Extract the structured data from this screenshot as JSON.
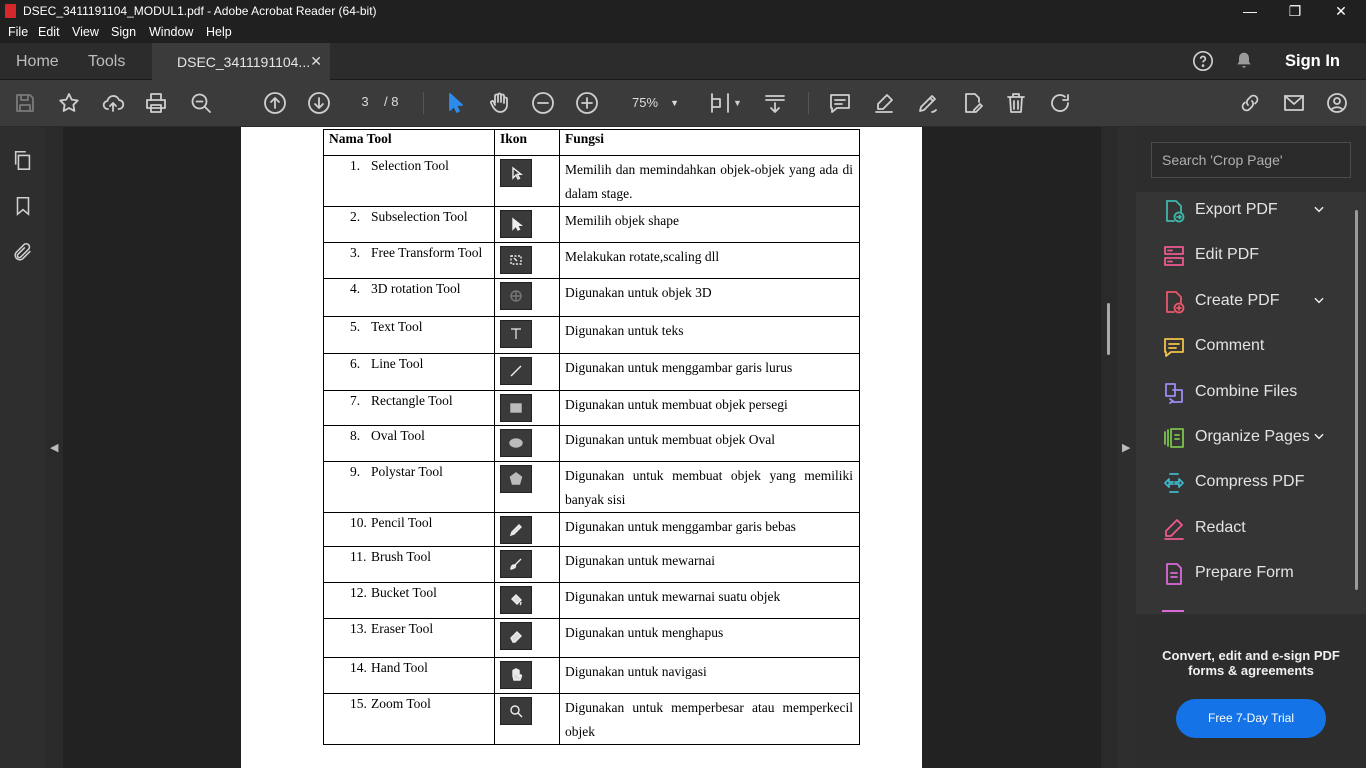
{
  "titlebar": {
    "title": "DSEC_3411191104_MODUL1.pdf - Adobe Acrobat Reader (64-bit)"
  },
  "menu": [
    "File",
    "Edit",
    "View",
    "Sign",
    "Window",
    "Help"
  ],
  "tabs": {
    "home": "Home",
    "tools": "Tools",
    "doc": "DSEC_3411191104...",
    "sign_in": "Sign In"
  },
  "toolbar": {
    "page_current": "3",
    "page_total": "/ 8",
    "zoom": "75%"
  },
  "right_panel": {
    "search_placeholder": "Search 'Crop Page'",
    "tools": [
      {
        "label": "Export PDF",
        "icon": "export-pdf-icon",
        "color": "#3fb6a8",
        "expandable": true
      },
      {
        "label": "Edit PDF",
        "icon": "edit-pdf-icon",
        "color": "#ec5a8f",
        "expandable": false
      },
      {
        "label": "Create PDF",
        "icon": "create-pdf-icon",
        "color": "#e8576b",
        "expandable": true
      },
      {
        "label": "Comment",
        "icon": "comment-icon",
        "color": "#f2c14a",
        "expandable": false
      },
      {
        "label": "Combine Files",
        "icon": "combine-files-icon",
        "color": "#9b8cf2",
        "expandable": false
      },
      {
        "label": "Organize Pages",
        "icon": "organize-pages-icon",
        "color": "#7cc24a",
        "expandable": true
      },
      {
        "label": "Compress PDF",
        "icon": "compress-pdf-icon",
        "color": "#3fb6c8",
        "expandable": false
      },
      {
        "label": "Redact",
        "icon": "redact-icon",
        "color": "#ec5a8f",
        "expandable": false
      },
      {
        "label": "Prepare Form",
        "icon": "prepare-form-icon",
        "color": "#d869d6",
        "expandable": false
      }
    ],
    "promo_text": "Convert, edit and e-sign PDF forms & agreements",
    "trial_button": "Free 7-Day Trial"
  },
  "document": {
    "headers": [
      "Nama Tool",
      "Ikon",
      "Fungsi"
    ],
    "rows": [
      {
        "num": "1.",
        "name": "Selection Tool",
        "icon": "selection-tool-icon",
        "fn": "Memilih dan memindahkan objek-objek yang ada di dalam stage."
      },
      {
        "num": "2.",
        "name": "Subselection Tool",
        "icon": "subselection-tool-icon",
        "fn": "Memilih objek shape"
      },
      {
        "num": "3.",
        "name": "Free Transform Tool",
        "icon": "free-transform-tool-icon",
        "fn": "Melakukan rotate,scaling dll"
      },
      {
        "num": "4.",
        "name": "3D rotation Tool",
        "icon": "3d-rotation-tool-icon",
        "fn": "Digunakan untuk objek 3D"
      },
      {
        "num": "5.",
        "name": "Text Tool",
        "icon": "text-tool-icon",
        "fn": "Digunakan untuk teks"
      },
      {
        "num": "6.",
        "name": "Line Tool",
        "icon": "line-tool-icon",
        "fn": "Digunakan untuk menggambar garis lurus"
      },
      {
        "num": "7.",
        "name": "Rectangle Tool",
        "icon": "rectangle-tool-icon",
        "fn": "Digunakan untuk membuat objek persegi"
      },
      {
        "num": "8.",
        "name": "Oval Tool",
        "icon": "oval-tool-icon",
        "fn": "Digunakan untuk membuat objek Oval"
      },
      {
        "num": "9.",
        "name": "Polystar Tool",
        "icon": "polystar-tool-icon",
        "fn": "Digunakan untuk membuat objek yang memiliki banyak sisi"
      },
      {
        "num": "10.",
        "name": "Pencil Tool",
        "icon": "pencil-tool-icon",
        "fn": "Digunakan untuk menggambar garis bebas"
      },
      {
        "num": "11.",
        "name": "Brush Tool",
        "icon": "brush-tool-icon",
        "fn": "Digunakan untuk mewarnai"
      },
      {
        "num": "12.",
        "name": "Bucket Tool",
        "icon": "bucket-tool-icon",
        "fn": "Digunakan untuk mewarnai suatu objek"
      },
      {
        "num": "13.",
        "name": "Eraser Tool",
        "icon": "eraser-tool-icon",
        "fn": "Digunakan untuk menghapus"
      },
      {
        "num": "14.",
        "name": "Hand Tool",
        "icon": "hand-tool-icon",
        "fn": "Digunakan untuk navigasi"
      },
      {
        "num": "15.",
        "name": "Zoom Tool",
        "icon": "zoom-tool-icon",
        "fn": "Digunakan untuk memperbesar atau memperkecil objek"
      }
    ]
  }
}
